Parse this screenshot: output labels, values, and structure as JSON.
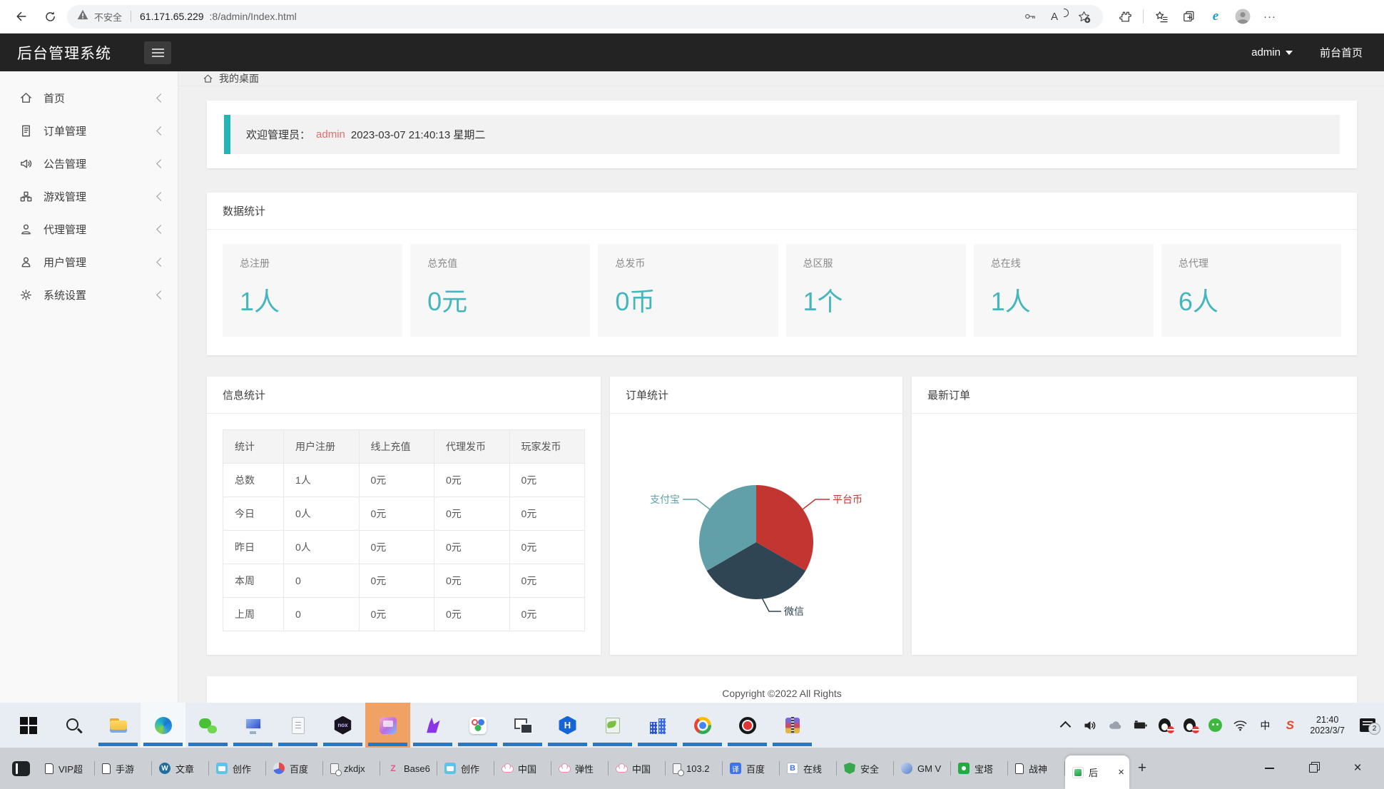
{
  "colors": {
    "accent": "#45b6bc",
    "welcome_border": "#26b3b3",
    "admin_red": "#e96b6b",
    "header_bg": "#232323",
    "taskbar_indicator": "#2678c6"
  },
  "browser": {
    "security_label": "不安全",
    "url_host": "61.171.65.229",
    "url_path": ":8/admin/Index.html",
    "readaloud_glyph": "A",
    "iemode_glyph": "e",
    "more_glyph": "···"
  },
  "header": {
    "title": "后台管理系统",
    "user": "admin",
    "frontend_link": "前台首页"
  },
  "sidebar": {
    "items": [
      {
        "label": "首页"
      },
      {
        "label": "订单管理"
      },
      {
        "label": "公告管理"
      },
      {
        "label": "游戏管理"
      },
      {
        "label": "代理管理"
      },
      {
        "label": "用户管理"
      },
      {
        "label": "系统设置"
      }
    ]
  },
  "breadcrumb": {
    "label": "我的桌面"
  },
  "welcome": {
    "prefix": "欢迎管理员：",
    "user": "admin",
    "datetime": "2023-03-07  21:40:13  星期二"
  },
  "stats": {
    "title": "数据统计",
    "cards": [
      {
        "label": "总注册",
        "value": "1人"
      },
      {
        "label": "总充值",
        "value": "0元"
      },
      {
        "label": "总发币",
        "value": "0币"
      },
      {
        "label": "总区服",
        "value": "1个"
      },
      {
        "label": "总在线",
        "value": "1人"
      },
      {
        "label": "总代理",
        "value": "6人"
      }
    ]
  },
  "info_table": {
    "title": "信息统计",
    "headers": [
      "统计",
      "用户注册",
      "线上充值",
      "代理发币",
      "玩家发币"
    ],
    "rows": [
      [
        "总数",
        "1人",
        "0元",
        "0元",
        "0元"
      ],
      [
        "今日",
        "0人",
        "0元",
        "0元",
        "0元"
      ],
      [
        "昨日",
        "0人",
        "0元",
        "0元",
        "0元"
      ],
      [
        "本周",
        "0",
        "0元",
        "0元",
        "0元"
      ],
      [
        "上周",
        "0",
        "0元",
        "0元",
        "0元"
      ]
    ]
  },
  "chart_data": {
    "type": "pie",
    "title": "订单统计",
    "labels": [
      "平台币",
      "微信",
      "支付宝"
    ],
    "values": [
      1,
      1,
      1
    ],
    "colors": [
      "#c23531",
      "#2f4554",
      "#61a0a8"
    ],
    "legend_position": "none",
    "label_layout": "leader-lines, slice-colored labels, equal thirds starting at 12 o'clock"
  },
  "orders_panel": {
    "title": "最新订单"
  },
  "footer": {
    "text": "Copyright ©2022 All Rights"
  },
  "taskbar": {
    "apps": [
      {
        "name": "start-button",
        "icon": "win"
      },
      {
        "name": "search-button",
        "icon": "search"
      },
      {
        "name": "file-explorer",
        "icon": "explorer",
        "state": "run"
      },
      {
        "name": "edge-browser",
        "icon": "edge",
        "state": "run hl"
      },
      {
        "name": "wechat",
        "icon": "wechat",
        "state": "run"
      },
      {
        "name": "remote-desktop",
        "icon": "remote",
        "state": "run"
      },
      {
        "name": "notepad",
        "icon": "notepad",
        "state": "run"
      },
      {
        "name": "nox-player",
        "icon": "nox",
        "state": "run",
        "glyph": "nox"
      },
      {
        "name": "game-app",
        "icon": "game",
        "state": "run active"
      },
      {
        "name": "phoenix-app",
        "icon": "phoenix",
        "state": "run"
      },
      {
        "name": "toolbox-app",
        "icon": "circles",
        "state": "run"
      },
      {
        "name": "snipping-tool",
        "icon": "snip",
        "state": "run"
      },
      {
        "name": "hbuilder",
        "icon": "hbuilder",
        "state": "run",
        "glyph": "H"
      },
      {
        "name": "notepad-plus-plus",
        "icon": "npp",
        "state": "run"
      },
      {
        "name": "buildings-app",
        "icon": "buildings",
        "state": "run"
      },
      {
        "name": "chrome-browser",
        "icon": "chrome",
        "state": "run"
      },
      {
        "name": "screen-recorder",
        "icon": "recorder",
        "state": "run"
      },
      {
        "name": "winrar",
        "icon": "winrar",
        "state": "run"
      }
    ],
    "tray": {
      "ime": "中",
      "sogou_glyph": "S",
      "time": "21:40",
      "date": "2023/3/7",
      "badge": "2"
    }
  },
  "tabstrip": {
    "tabs": [
      {
        "label": "VIP超",
        "icon": "page"
      },
      {
        "label": "手游",
        "icon": "page"
      },
      {
        "label": "文章",
        "icon": "wordpress",
        "glyph": "W"
      },
      {
        "label": "创作",
        "icon": "bilibili"
      },
      {
        "label": "百度",
        "icon": "baidu"
      },
      {
        "label": "zkdjx",
        "icon": "pagex"
      },
      {
        "label": "Base6",
        "icon": "zj",
        "glyph": "Z"
      },
      {
        "label": "创作",
        "icon": "bilibili"
      },
      {
        "label": "中国",
        "icon": "cloud-pink"
      },
      {
        "label": "弹性",
        "icon": "cloud-pink"
      },
      {
        "label": "中国",
        "icon": "cloud-pink"
      },
      {
        "label": "103.2",
        "icon": "pagex"
      },
      {
        "label": "百度",
        "icon": "translate",
        "glyph": "译"
      },
      {
        "label": "在线",
        "icon": "bsquare",
        "glyph": "B"
      },
      {
        "label": "安全",
        "icon": "shield-green"
      },
      {
        "label": "GM V",
        "icon": "gm"
      },
      {
        "label": "宝塔",
        "icon": "bt"
      },
      {
        "label": "战神",
        "icon": "page"
      }
    ],
    "active_tab": {
      "label": "后",
      "icon": "flame"
    },
    "close_glyph": "×",
    "new_tab_glyph": "+"
  }
}
